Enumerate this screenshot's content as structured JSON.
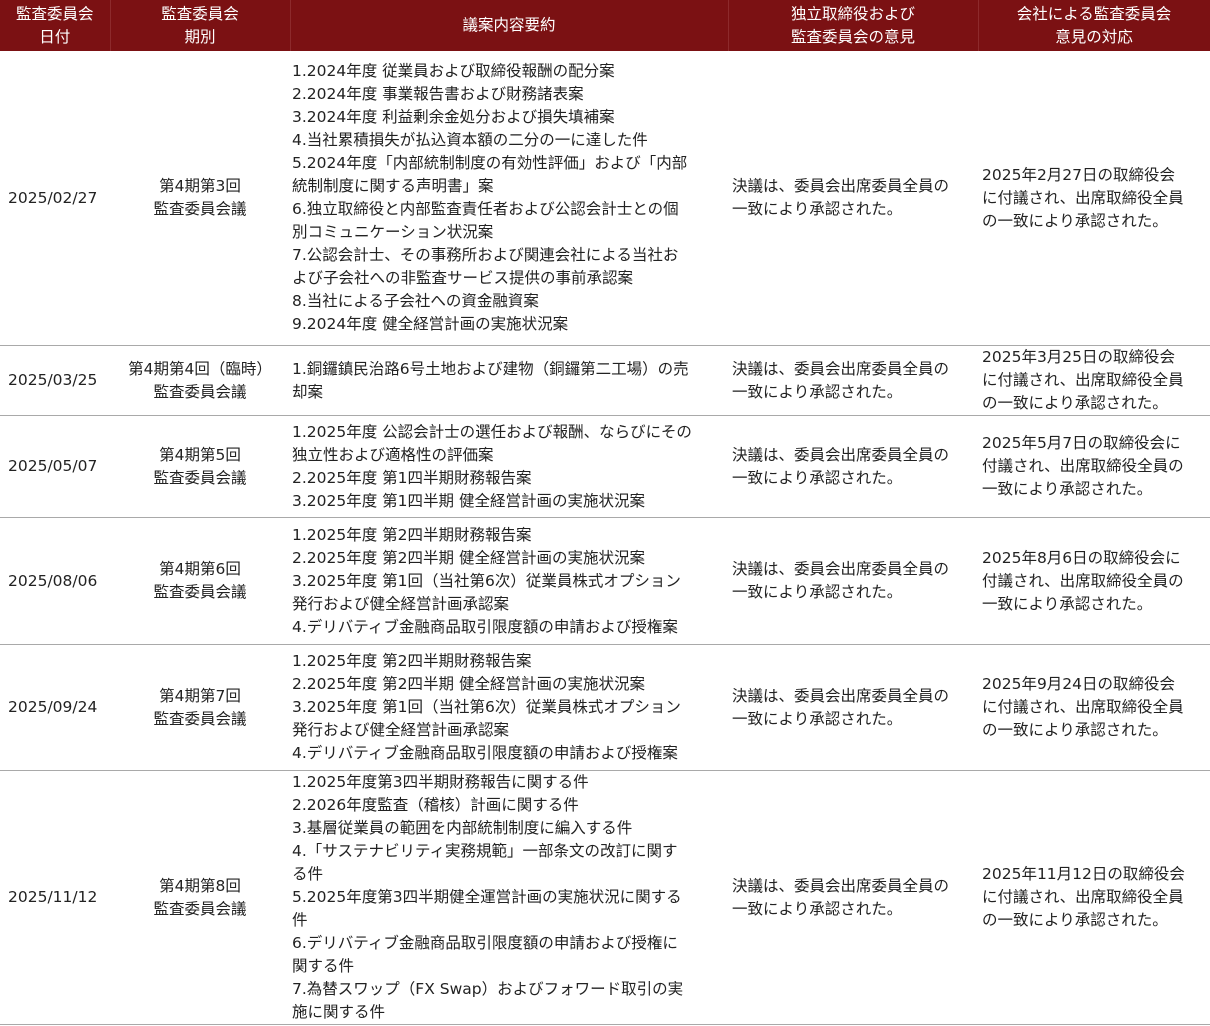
{
  "headers": {
    "date": [
      "監査委員会",
      "日付"
    ],
    "term": [
      "監査委員会",
      "期別"
    ],
    "summary": [
      "議案内容要約"
    ],
    "opinion": [
      "独立取締役および",
      "監査委員会の意見"
    ],
    "response": [
      "会社による監査委員会",
      "意見の対応"
    ]
  },
  "rows": [
    {
      "date": "2025/02/27",
      "term": [
        "第4期第3回",
        "監査委員会議"
      ],
      "summary": [
        "1.2024年度 従業員および取締役報酬の配分案",
        "2.2024年度 事業報告書および財務諸表案",
        "3.2024年度 利益剰余金処分および損失填補案",
        "4.当社累積損失が払込資本額の二分の一に達した件",
        "5.2024年度「内部統制制度の有効性評価」および「内部",
        "統制制度に関する声明書」案",
        "6.独立取締役と内部監査責任者および公認会計士との個",
        "別コミュニケーション状況案",
        "7.公認会計士、その事務所および関連会社による当社お",
        "よび子会社への非監査サービス提供の事前承認案",
        "8.当社による子会社への資金融資案",
        "9.2024年度 健全経営計画の実施状況案"
      ],
      "opinion": [
        "決議は、委員会出席委員全員の",
        "一致により承認された。"
      ],
      "response": [
        "2025年2月27日の取締役会",
        "に付議され、出席取締役全員",
        "の一致により承認された。"
      ]
    },
    {
      "date": "2025/03/25",
      "term": [
        "第4期第4回（臨時）",
        "監査委員会議"
      ],
      "summary": [
        "1.銅鑼鎮民治路6号土地および建物（銅鑼第二工場）の売",
        "却案"
      ],
      "opinion": [
        "決議は、委員会出席委員全員の",
        "一致により承認された。"
      ],
      "response": [
        "2025年3月25日の取締役会",
        "に付議され、出席取締役全員",
        "の一致により承認された。"
      ]
    },
    {
      "date": "2025/05/07",
      "term": [
        "第4期第5回",
        "監査委員会議"
      ],
      "summary": [
        "1.2025年度 公認会計士の選任および報酬、ならびにその",
        "独立性および適格性の評価案",
        "2.2025年度 第1四半期財務報告案",
        "3.2025年度 第1四半期 健全経営計画の実施状況案"
      ],
      "opinion": [
        "決議は、委員会出席委員全員の",
        "一致により承認された。"
      ],
      "response": [
        "2025年5月7日の取締役会に",
        "付議され、出席取締役全員の",
        "一致により承認された。"
      ]
    },
    {
      "date": "2025/08/06",
      "term": [
        "第4期第6回",
        "監査委員会議"
      ],
      "summary": [
        "1.2025年度 第2四半期財務報告案",
        "2.2025年度 第2四半期 健全経営計画の実施状況案",
        "3.2025年度 第1回（当社第6次）従業員株式オプション",
        "発行および健全経営計画承認案",
        "4.デリバティブ金融商品取引限度額の申請および授権案"
      ],
      "opinion": [
        "決議は、委員会出席委員全員の",
        "一致により承認された。"
      ],
      "response": [
        "2025年8月6日の取締役会に",
        "付議され、出席取締役全員の",
        "一致により承認された。"
      ]
    },
    {
      "date": "2025/09/24",
      "term": [
        "第4期第7回",
        "監査委員会議"
      ],
      "summary": [
        "1.2025年度 第2四半期財務報告案",
        "2.2025年度 第2四半期 健全経営計画の実施状況案",
        "3.2025年度 第1回（当社第6次）従業員株式オプション",
        "発行および健全経営計画承認案",
        "4.デリバティブ金融商品取引限度額の申請および授権案"
      ],
      "opinion": [
        "決議は、委員会出席委員全員の",
        "一致により承認された。"
      ],
      "response": [
        "2025年9月24日の取締役会",
        "に付議され、出席取締役全員",
        "の一致により承認された。"
      ]
    },
    {
      "date": "2025/11/12",
      "term": [
        "第4期第8回",
        "監査委員会議"
      ],
      "summary": [
        "1.2025年度第3四半期財務報告に関する件",
        "2.2026年度監査（稽核）計画に関する件",
        "3.基層従業員の範囲を内部統制制度に編入する件",
        "4.「サステナビリティ実務規範」一部条文の改訂に関す",
        "る件",
        "5.2025年度第3四半期健全運営計画の実施状況に関する",
        "件",
        "6.デリバティブ金融商品取引限度額の申請および授権に",
        "関する件",
        "7.為替スワップ（FX Swap）およびフォワード取引の実",
        "施に関する件"
      ],
      "opinion": [
        "決議は、委員会出席委員全員の",
        "一致により承認された。"
      ],
      "response": [
        "2025年11月12日の取締役会",
        "に付議され、出席取締役全員",
        "の一致により承認された。"
      ]
    }
  ]
}
